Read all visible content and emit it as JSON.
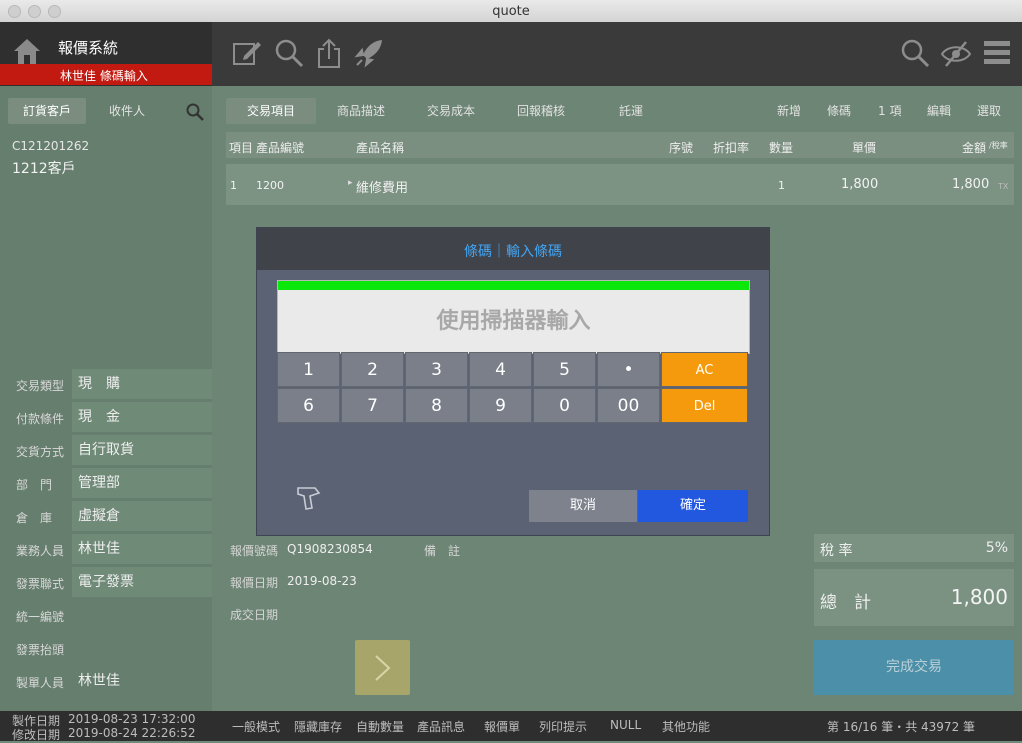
{
  "window": {
    "title": "quote"
  },
  "brand": {
    "name": "報價系統",
    "subtitle": "林世佳  條碼輸入"
  },
  "customer_tabs": {
    "order": "訂貨客戶",
    "receiver": "收件人"
  },
  "customer": {
    "id": "C121201262",
    "name": "1212客戶"
  },
  "tabs": [
    "交易項目",
    "商品描述",
    "交易成本",
    "回報稽核",
    "託運"
  ],
  "actions": {
    "add": "新增",
    "barcode": "條碼",
    "count": "1 項",
    "edit": "編輯",
    "select": "選取"
  },
  "columns": {
    "item": "項目",
    "code": "產品編號",
    "name": "產品名稱",
    "seq": "序號",
    "discount": "折扣率",
    "qty": "數量",
    "price": "單價",
    "amount": "金額",
    "tax_note": "/稅率"
  },
  "rows": [
    {
      "item": "1",
      "code": "1200",
      "name": "維修費用",
      "qty": "1",
      "price": "1,800",
      "amount": "1,800",
      "tax": "TX"
    }
  ],
  "left_fields": [
    {
      "label": "交易類型",
      "value": "現　購"
    },
    {
      "label": "付款條件",
      "value": "現　金"
    },
    {
      "label": "交貨方式",
      "value": "自行取貨"
    },
    {
      "label": "部　門",
      "value": "管理部"
    },
    {
      "label": "倉　庫",
      "value": "虛擬倉"
    },
    {
      "label": "業務人員",
      "value": "林世佳"
    },
    {
      "label": "發票聯式",
      "value": "電子發票"
    },
    {
      "label": "統一編號",
      "value": ""
    },
    {
      "label": "發票抬頭",
      "value": ""
    },
    {
      "label": "製單人員",
      "value": "林世佳"
    }
  ],
  "info": {
    "quote_no_label": "報價號碼",
    "quote_no": "Q1908230854",
    "remark_label": "備　註",
    "quote_date_label": "報價日期",
    "quote_date": "2019-08-23",
    "deal_date_label": "成交日期"
  },
  "totals": {
    "tax_label": "稅 率",
    "tax_value": "5%",
    "total_label": "總　計",
    "total_value": "1,800",
    "complete": "完成交易"
  },
  "modal": {
    "title": "條碼｜輸入條碼",
    "placeholder": "使用掃描器輸入",
    "keys_row1": [
      "1",
      "2",
      "3",
      "4",
      "5",
      "•"
    ],
    "keys_row2": [
      "6",
      "7",
      "8",
      "9",
      "0",
      "00"
    ],
    "ac": "AC",
    "del": "Del",
    "cancel": "取消",
    "confirm": "確定"
  },
  "footer": {
    "created_label": "製作日期",
    "created": "2019-08-23  17:32:00",
    "modified_label": "修改日期",
    "modified": "2019-08-24  22:26:52",
    "modes": [
      "一般模式",
      "隱藏庫存",
      "自動數量",
      "產品訊息",
      "報價單",
      "列印提示",
      "NULL",
      "其他功能"
    ],
    "record": "第 16/16 筆・共 43972 筆"
  },
  "colors": {
    "accent_red": "#c21a10",
    "confirm_blue": "#2257e0",
    "key_orange": "#f59a0c",
    "scan_green": "#0be60b",
    "title_blue": "#43a6f5"
  }
}
